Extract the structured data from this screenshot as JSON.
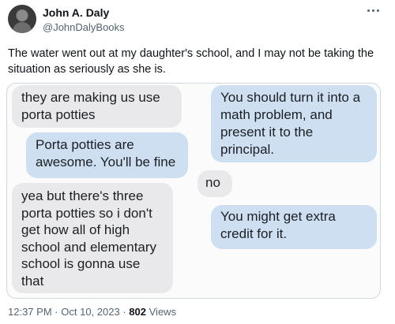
{
  "author": {
    "name": "John A. Daly",
    "handle": "@JohnDalyBooks"
  },
  "tweet": {
    "text": "The water went out at my daughter's school, and I may not be taking the situation as seriously as she is."
  },
  "conversation": {
    "messages": [
      {
        "side": "left",
        "text": "they are making us use porta potties"
      },
      {
        "side": "left",
        "text": "Porta potties are awesome. You'll be fine"
      },
      {
        "side": "left",
        "text": "yea but there's three porta potties so i don't get how all of high school and elementary school is gonna use that"
      },
      {
        "side": "right",
        "text": "You should turn it into a math problem, and present it to the principal."
      },
      {
        "side": "right",
        "text": "no"
      },
      {
        "side": "right",
        "text": "You might get extra credit for it."
      }
    ]
  },
  "footer": {
    "time": "12:37 PM",
    "separator": "·",
    "date": "Oct 10, 2023",
    "views_count": "802",
    "views_label": "Views"
  },
  "colors": {
    "bubble_gray": "#e9e9ec",
    "bubble_blue": "#cfdff2",
    "secondary_text": "#536471"
  },
  "icons": {
    "more": "more-dots-icon"
  }
}
